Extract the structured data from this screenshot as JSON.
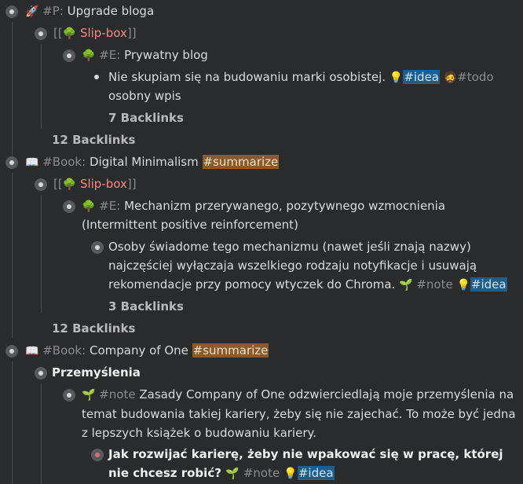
{
  "blocks": [
    {
      "prefix": "#P:",
      "title": "Upgrade bloga",
      "icon": "rocket-icon"
    },
    {
      "link_open": "[[",
      "link_text": "Slip-box",
      "link_close": "]]"
    },
    {
      "prefix": "#E:",
      "title": "Prywatny blog"
    },
    {
      "text": "Nie skupiam się na budowaniu marki osobistej.",
      "tag1": "#idea",
      "tag2": "#todo",
      "text2": "osobny wpis"
    },
    {
      "backlinks": "7 Backlinks"
    },
    {
      "backlinks": "12 Backlinks"
    },
    {
      "prefix": "#Book:",
      "title": "Digital Minimalism",
      "tag": "#summarize"
    },
    {
      "link_open": "[[",
      "link_text": "Slip-box",
      "link_close": "]]"
    },
    {
      "prefix": "#E:",
      "title_line1": "Mechanizm przerywanego, pozytywnego wzmocnienia",
      "title_line2": "(Intermittent positive reinforcement)"
    },
    {
      "text": "Osoby świadome tego mechanizmu (nawet jeśli znają nazwy) najczęściej wyłączaja wszelkiego rodzaju notyfikacje i usuwają rekomendacje przy pomocy wtyczek do Chroma.",
      "tag1": "#note",
      "tag2": "#idea"
    },
    {
      "backlinks": "3 Backlinks"
    },
    {
      "backlinks": "12 Backlinks"
    },
    {
      "prefix": "#Book:",
      "title": "Company of One",
      "tag": "#summarize"
    },
    {
      "title": "Przemyślenia"
    },
    {
      "prefix": "#note",
      "text": "Zasady Company of One odzwierciedlają moje przemyślenia na temat budowania takiej kariery, żeby się nie zajechać. To może być jedna z lepszych książek o budowaniu kariery."
    },
    {
      "text": "Jak rozwijać karierę, żeby nie wpakować się w pracę, której nie chcesz robić?",
      "tag1": "#note",
      "tag2": "#idea"
    }
  ]
}
